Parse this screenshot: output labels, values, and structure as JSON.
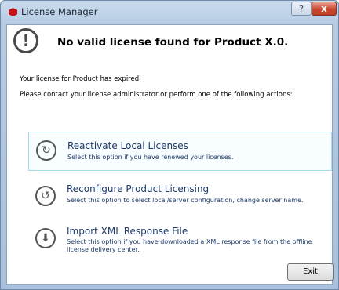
{
  "window": {
    "title": "License Manager",
    "help_label": "?",
    "close_label": "x"
  },
  "header": {
    "icon": "exclamation-circle-icon",
    "icon_glyph": "!",
    "title": "No valid license found for Product X.0."
  },
  "messages": [
    "Your license for Product has expired.",
    "Please contact your license administrator or perform one of the following actions:"
  ],
  "options": [
    {
      "title": "Reactivate Local Licenses",
      "description": "Select this option if you have renewed your licenses.",
      "icon": "refresh-icon",
      "glyph": "↻",
      "selected": true
    },
    {
      "title": "Reconfigure Product Licensing",
      "description": "Select this option to select local/server configuration, change server name.",
      "icon": "undo-icon",
      "glyph": "↺",
      "selected": false
    },
    {
      "title": "Import XML Response File",
      "description": "Select this option if you have downloaded a XML response file from the offline license delivery center.",
      "icon": "download-icon",
      "glyph": "⬇",
      "selected": false
    }
  ],
  "footer": {
    "exit_label": "Exit"
  },
  "colors": {
    "option_text": "#1c3a6a",
    "selection_border": "#a5ddee",
    "app_icon": "#c0141b"
  }
}
